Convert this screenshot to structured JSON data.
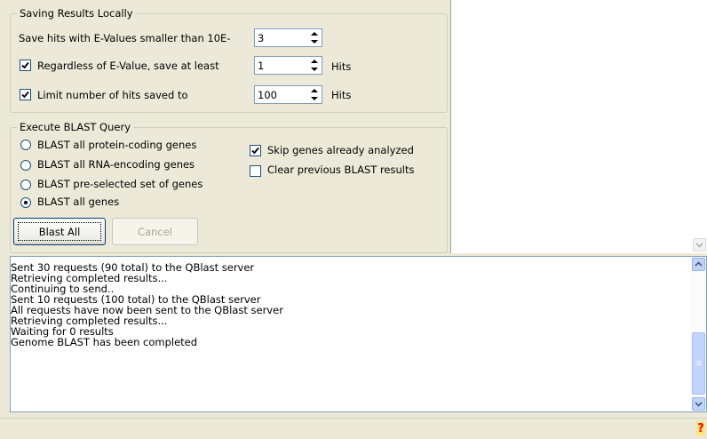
{
  "saving_group": {
    "legend": "Saving Results Locally",
    "evalue_label": "Save hits with E-Values smaller than 10E-",
    "evalue_value": "3",
    "regardless_label": "Regardless of E-Value, save at least",
    "regardless_checked": true,
    "regardless_value": "1",
    "regardless_unit": "Hits",
    "limit_label": "Limit number of hits saved to",
    "limit_checked": true,
    "limit_value": "100",
    "limit_unit": "Hits"
  },
  "execute_group": {
    "legend": "Execute BLAST Query",
    "radios": [
      {
        "label": "BLAST all protein-coding genes",
        "selected": false
      },
      {
        "label": "BLAST all RNA-encoding genes",
        "selected": false
      },
      {
        "label": "BLAST pre-selected set of genes",
        "selected": false
      },
      {
        "label": "BLAST all genes",
        "selected": true
      }
    ],
    "skip_label": "Skip genes already analyzed",
    "skip_checked": true,
    "clear_label": "Clear previous BLAST results",
    "clear_checked": false,
    "blast_button": "Blast All",
    "cancel_button": "Cancel"
  },
  "log": {
    "lines": [
      "Sent 30 requests (90 total) to the QBlast server",
      "Retrieving completed results...",
      "Continuing to send..",
      "Sent 10 requests (100 total) to the QBlast server",
      "All requests have now been sent to the QBlast server",
      "Retrieving completed results...",
      "Waiting for 0 results",
      "Genome BLAST has been completed"
    ]
  },
  "status": {
    "help_glyph": "?"
  },
  "colors": {
    "panel": "#ece9d8",
    "input_border": "#7f9db9",
    "scroll_blue": "#c1d3fb",
    "help_red": "#ff0000"
  },
  "icons": [
    "checkmark-icon",
    "radio-dot-icon",
    "spin-up-icon",
    "spin-down-icon",
    "scroll-up-icon",
    "scroll-down-icon",
    "help-icon"
  ]
}
